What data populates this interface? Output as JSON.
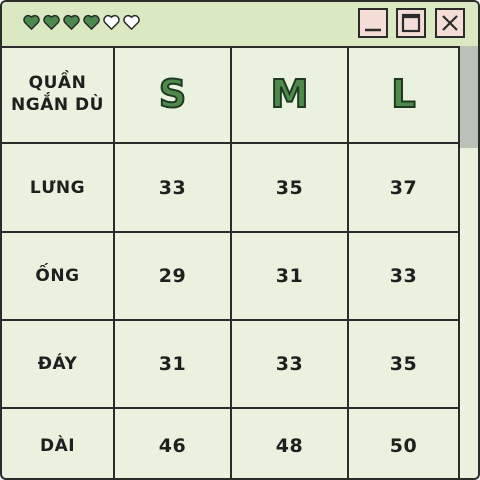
{
  "window": {
    "hearts": [
      {
        "state": "filled",
        "icon": "heart-filled-icon"
      },
      {
        "state": "filled",
        "icon": "heart-filled-icon"
      },
      {
        "state": "filled",
        "icon": "heart-filled-icon"
      },
      {
        "state": "filled",
        "icon": "heart-filled-icon"
      },
      {
        "state": "empty",
        "icon": "heart-outline-icon"
      },
      {
        "state": "empty",
        "icon": "heart-outline-icon"
      }
    ],
    "buttons": {
      "minimize": "minimize-icon",
      "maximize": "maximize-icon",
      "close": "close-icon"
    },
    "colors": {
      "titlebar": "#dbe9c3",
      "body": "#eaf1df",
      "heart": "#4b8a4f",
      "button_bg": "#f4ddd6",
      "size_letter": "#4f8a4b"
    }
  },
  "table": {
    "corner_line1": "QUẦN",
    "corner_line2": "NGẮN DÙ",
    "sizes": [
      "S",
      "M",
      "L"
    ],
    "rows": [
      {
        "label": "LƯNG",
        "values": [
          "33",
          "35",
          "37"
        ]
      },
      {
        "label": "ỐNG",
        "values": [
          "29",
          "31",
          "33"
        ]
      },
      {
        "label": "ĐÁY",
        "values": [
          "31",
          "33",
          "35"
        ]
      },
      {
        "label": "DÀI",
        "values": [
          "46",
          "48",
          "50"
        ]
      }
    ]
  },
  "scrollbar": {
    "position": 0
  }
}
